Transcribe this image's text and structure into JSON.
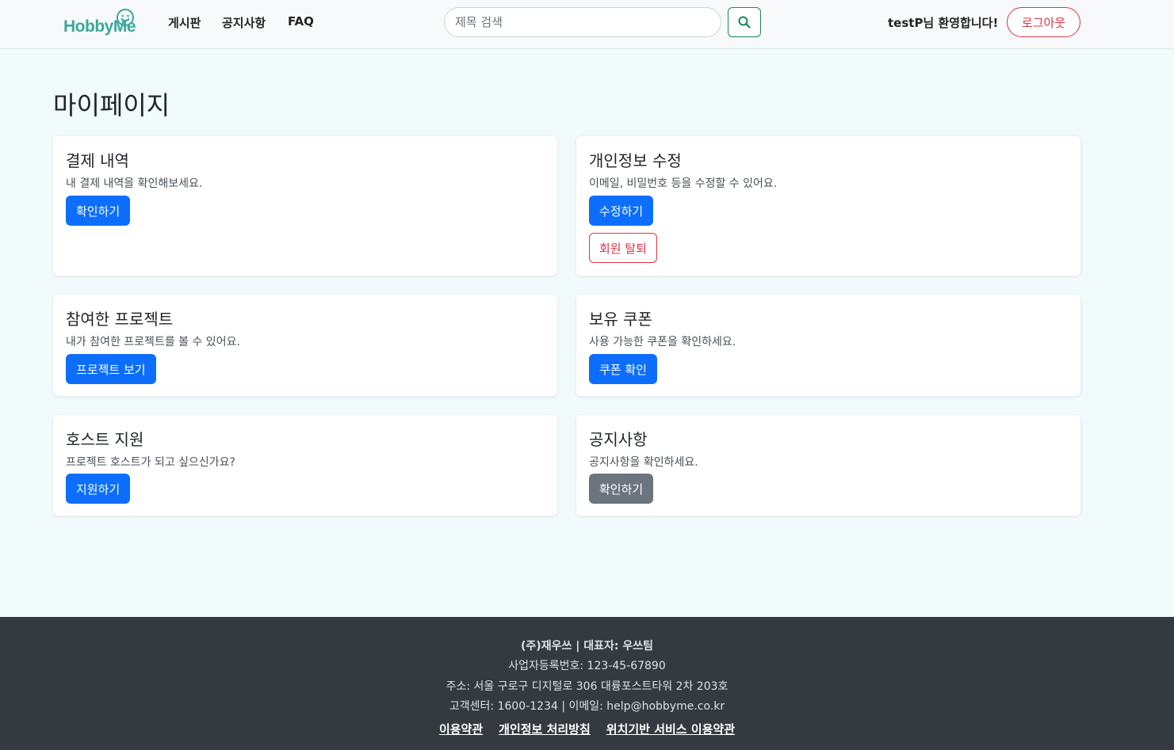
{
  "header": {
    "logo_text": "HobbyMe",
    "nav": [
      "게시판",
      "공지사항",
      "FAQ"
    ],
    "search_placeholder": "제목 검색",
    "welcome": "testP님 환영합니다!",
    "logout_label": "로그아웃"
  },
  "page": {
    "title": "마이페이지"
  },
  "cards": [
    {
      "title": "결제 내역",
      "text": "내 결제 내역을 확인해보세요.",
      "buttons": [
        "확인하기"
      ]
    },
    {
      "title": "개인정보 수정",
      "text": "이메일, 비밀번호 등을 수정할 수 있어요.",
      "buttons": [
        "수정하기",
        "회원 탈퇴"
      ]
    },
    {
      "title": "참여한 프로젝트",
      "text": "내가 참여한 프로젝트를 볼 수 있어요.",
      "buttons": [
        "프로젝트 보기"
      ]
    },
    {
      "title": "보유 쿠폰",
      "text": "사용 가능한 쿠폰을 확인하세요.",
      "buttons": [
        "쿠폰 확인"
      ]
    },
    {
      "title": "호스트 지원",
      "text": "프로젝트 호스트가 되고 싶으신가요?",
      "buttons": [
        "지원하기"
      ]
    },
    {
      "title": "공지사항",
      "text": "공지사항을 확인하세요.",
      "buttons": [
        "확인하기"
      ]
    }
  ],
  "footer": {
    "company": "(주)재우쓰 | 대표자: 우쓰팀",
    "business_no": "사업자등록번호: 123-45-67890",
    "address": "주소: 서울 구로구 디지털로 306 대륭포스트타워 2차 203호",
    "contact": "고객센터: 1600-1234 | 이메일: help@hobbyme.co.kr",
    "links": [
      "이용약관",
      "개인정보 처리방침",
      "위치기반 서비스 이용약관"
    ]
  },
  "colors": {
    "primary": "#0d6efd",
    "secondary": "#6c757d",
    "danger": "#dc3545",
    "success": "#198754",
    "brand": "#3aa89b",
    "footer_bg": "#343a40",
    "page_bg": "#f1fbfb"
  },
  "icons": {
    "logo": "smiley-face-icon",
    "search": "search-icon"
  }
}
